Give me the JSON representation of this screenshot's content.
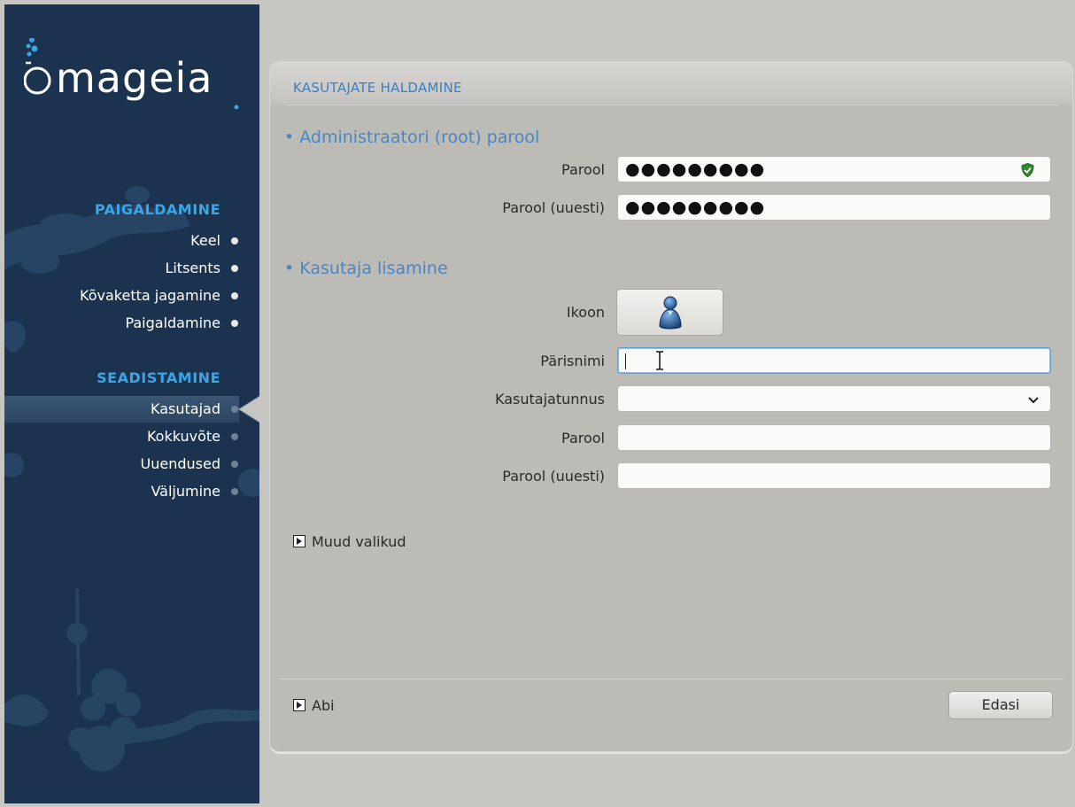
{
  "app": {
    "logo_text": "mageia"
  },
  "sidebar": {
    "sections": [
      {
        "title": "PAIGALDAMINE",
        "steps": [
          {
            "label": "Keel",
            "state": "done"
          },
          {
            "label": "Litsents",
            "state": "done"
          },
          {
            "label": "Kõvaketta jagamine",
            "state": "done"
          },
          {
            "label": "Paigaldamine",
            "state": "done"
          }
        ]
      },
      {
        "title": "SEADISTAMINE",
        "steps": [
          {
            "label": "Kasutajad",
            "state": "current"
          },
          {
            "label": "Kokkuvõte",
            "state": "pending"
          },
          {
            "label": "Uuendused",
            "state": "pending"
          },
          {
            "label": "Väljumine",
            "state": "pending"
          }
        ]
      }
    ]
  },
  "main": {
    "title": "KASUTAJATE HALDAMINE",
    "admin_group": {
      "title": "• Administraatori (root) parool",
      "password_label": "Parool",
      "password_value": "●●●●●●●●●",
      "password_repeat_label": "Parool (uuesti)",
      "password_repeat_value": "●●●●●●●●●",
      "strength_icon": "shield-check-icon"
    },
    "user_group": {
      "title": "• Kasutaja lisamine",
      "icon_label": "Ikoon",
      "icon_value": "user-icon",
      "realname_label": "Pärisnimi",
      "realname_value": "",
      "username_label": "Kasutajatunnus",
      "username_value": "",
      "password_label": "Parool",
      "password_value": "",
      "password_repeat_label": "Parool (uuesti)",
      "password_repeat_value": ""
    },
    "more_options_label": "Muud valikud",
    "help_label": "Abi",
    "next_button": "Edasi"
  },
  "colors": {
    "sidebar_bg": "#1c3350",
    "section_title": "#3aa6e6",
    "accent_title": "#4a86c5",
    "panel_bg": "#bdbbb6"
  }
}
